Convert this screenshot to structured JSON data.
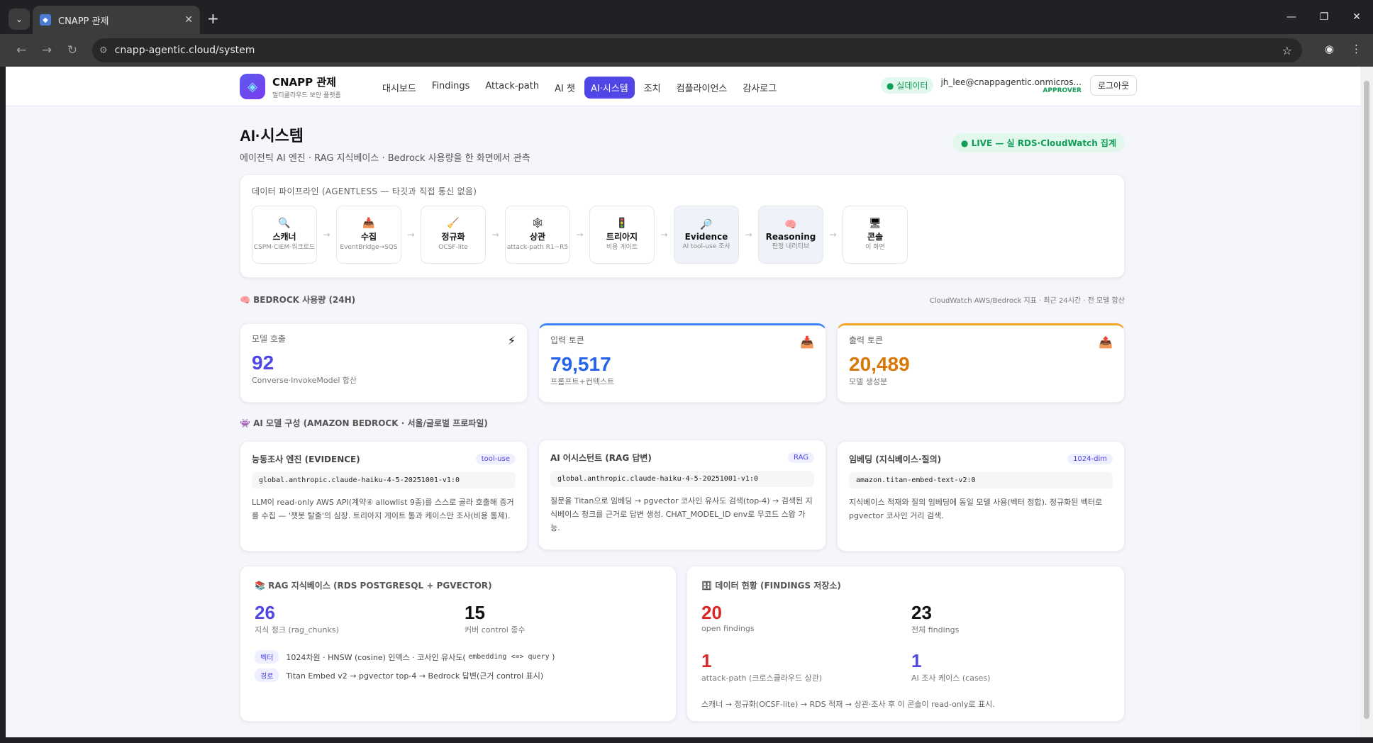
{
  "browser": {
    "tab_title": "CNAPP 관제",
    "url": "cnapp-agentic.cloud/system"
  },
  "header": {
    "brand": "CNAPP 관제",
    "brand_sub": "멀티클라우드 보안 플랫폼",
    "nav": [
      "대시보드",
      "Findings",
      "Attack-path",
      "AI 챗",
      "AI·시스템",
      "조치",
      "컴플라이언스",
      "감사로그"
    ],
    "live_badge": "● 실데이터",
    "user_email": "jh_lee@cnappagentic.onmicros...",
    "user_role": "APPROVER",
    "logout": "로그아웃"
  },
  "page": {
    "title": "AI·시스템",
    "subtitle": "에이전틱 AI 엔진 · RAG 지식베이스 · Bedrock 사용량을 한 화면에서 관측",
    "live_pill": "● LIVE — 실 RDS·CloudWatch 집계"
  },
  "pipeline": {
    "label": "데이터 파이프라인 (AGENTLESS — 타깃과 직접 통신 없음)",
    "steps": [
      {
        "icon": "🔍",
        "name": "스캐너",
        "desc": "CSPM·CIEM·워크로드"
      },
      {
        "icon": "📥",
        "name": "수집",
        "desc": "EventBridge→SQS"
      },
      {
        "icon": "🧹",
        "name": "정규화",
        "desc": "OCSF-lite"
      },
      {
        "icon": "🕸",
        "name": "상관",
        "desc": "attack-path R1~R5"
      },
      {
        "icon": "🚦",
        "name": "트리아지",
        "desc": "비용 게이트"
      },
      {
        "icon": "🔎",
        "name": "Evidence",
        "desc": "AI tool-use 조사"
      },
      {
        "icon": "🧠",
        "name": "Reasoning",
        "desc": "판정 내러티브"
      },
      {
        "icon": "🖥",
        "name": "콘솔",
        "desc": "이 화면"
      }
    ]
  },
  "bedrock": {
    "label": "🧠 BEDROCK 사용량 (24H)",
    "note": "CloudWatch AWS/Bedrock 지표 · 최근 24시간 · 전 모델 합산",
    "kpis": [
      {
        "title": "모델 호출",
        "value": "92",
        "sub": "Converse·InvokeModel 합산",
        "icon": "⚡",
        "color": "#4f46e5"
      },
      {
        "title": "입력 토큰",
        "value": "79,517",
        "sub": "프롬프트+컨텍스트",
        "icon": "📥",
        "color": "#2563eb"
      },
      {
        "title": "출력 토큰",
        "value": "20,489",
        "sub": "모델 생성분",
        "icon": "📤",
        "color": "#d97706"
      }
    ]
  },
  "models": {
    "label": "👾 AI 모델 구성 (AMAZON BEDROCK · 서울/글로벌 프로파일)",
    "cards": [
      {
        "title": "능동조사 엔진 (EVIDENCE)",
        "badge": "tool-use",
        "model_id": "global.anthropic.claude-haiku-4-5-20251001-v1:0",
        "desc": "LLM이 read-only AWS API(계약④ allowlist 9종)를 스스로 골라 호출해 증거를 수집 — '챗봇 탈출'의 심장. 트리아지 게이트 통과 케이스만 조사(비용 통제)."
      },
      {
        "title": "AI 어시스턴트 (RAG 답변)",
        "badge": "RAG",
        "model_id": "global.anthropic.claude-haiku-4-5-20251001-v1:0",
        "desc": "질문을 Titan으로 임베딩 → pgvector 코사인 유사도 검색(top-4) → 검색된 지식베이스 청크를 근거로 답변 생성. CHAT_MODEL_ID env로 무코드 스왑 가능."
      },
      {
        "title": "임베딩 (지식베이스·질의)",
        "badge": "1024-dim",
        "model_id": "amazon.titan-embed-text-v2:0",
        "desc": "지식베이스 적재와 질의 임베딩에 동일 모델 사용(벡터 정합). 정규화된 벡터로 pgvector 코사인 거리 검색."
      }
    ]
  },
  "rag": {
    "title": "📚 RAG 지식베이스 (RDS POSTGRESQL + PGVECTOR)",
    "chunks": "26",
    "chunks_label": "지식 청크 (rag_chunks)",
    "controls": "15",
    "controls_label": "커버 control 종수",
    "row1_tag": "벡터",
    "row1_text": "1024차원 · HNSW (cosine) 인덱스 · 코사인 유사도(",
    "row1_code": "embedding <=> query",
    "row1_end": ")",
    "row2_tag": "경로",
    "row2_text": "Titan Embed v2 → pgvector top-4 → Bedrock 답변(근거 control 표시)"
  },
  "findings": {
    "title": "🗄 데이터 현황 (FINDINGS 저장소)",
    "open": "20",
    "open_label": "open findings",
    "total": "23",
    "total_label": "전체 findings",
    "attack": "1",
    "attack_label": "attack-path (크로스클라우드 상관)",
    "cases": "1",
    "cases_label": "AI 조사 케이스 (cases)",
    "footer": "스캐너 → 정규화(OCSF-lite) → RDS 적재 → 상관·조사 후 이 콘솔이 read-only로 표시."
  }
}
